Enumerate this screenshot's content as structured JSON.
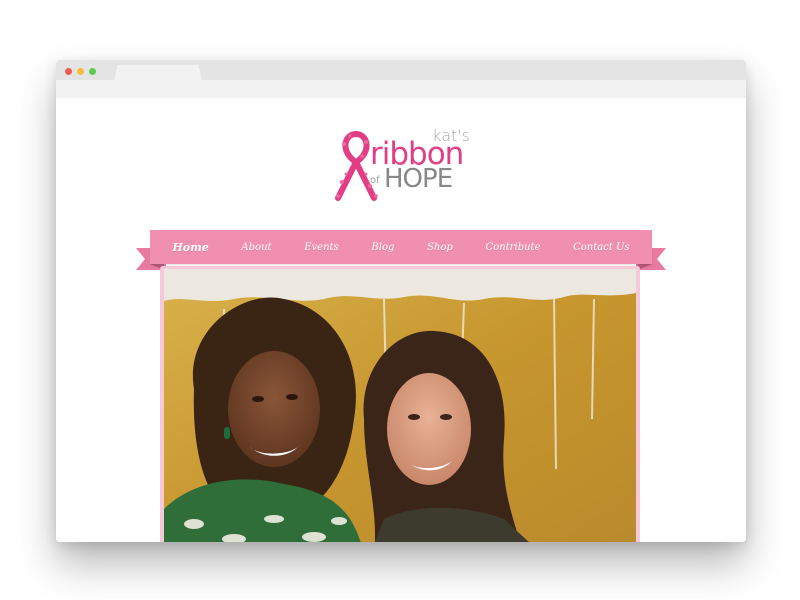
{
  "browser": {
    "window_controls": [
      "close",
      "minimize",
      "maximize"
    ]
  },
  "logo": {
    "line1": "kat's",
    "line2": "ribbon",
    "line3_prefix": "of",
    "line3": "HOPE",
    "alt": "kat's ribbon of HOPE"
  },
  "nav": {
    "items": [
      {
        "label": "Home",
        "active": true
      },
      {
        "label": "About",
        "active": false
      },
      {
        "label": "Events",
        "active": false
      },
      {
        "label": "Blog",
        "active": false
      },
      {
        "label": "Shop",
        "active": false
      },
      {
        "label": "Contribute",
        "active": false
      },
      {
        "label": "Contact Us",
        "active": false
      }
    ]
  },
  "colors": {
    "brand_pink": "#e23e86",
    "nav_pink": "#f18fb1",
    "logo_gray": "#888888"
  },
  "hero": {
    "alt": "Photo of two smiling women in front of a gold painted wall"
  }
}
